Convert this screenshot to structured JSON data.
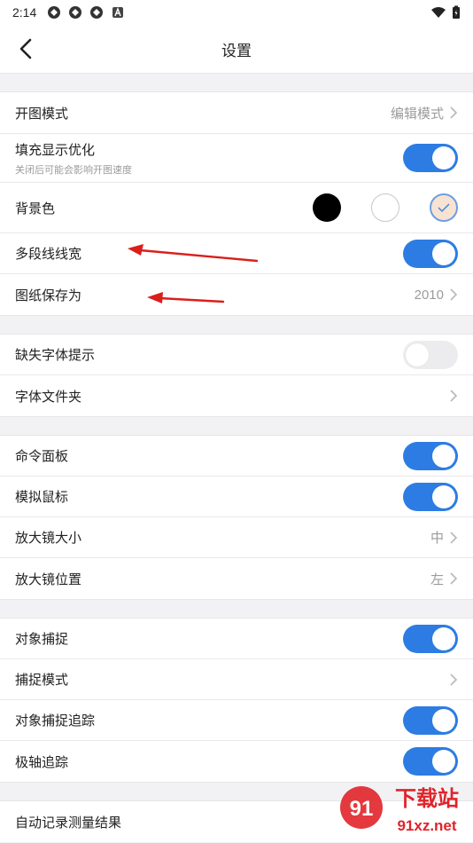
{
  "status_bar": {
    "time": "2:14"
  },
  "header": {
    "title": "设置"
  },
  "groups": {
    "display": {
      "open_mode": {
        "label": "开图模式",
        "value": "编辑模式"
      },
      "fill_opt": {
        "label": "填充显示优化",
        "sublabel": "关闭后可能会影响开图速度",
        "on": true
      },
      "bg_color": {
        "label": "背景色",
        "options": [
          "black",
          "white",
          "peach"
        ],
        "selected": "peach"
      },
      "polyline_width": {
        "label": "多段线线宽",
        "on": true
      },
      "save_as": {
        "label": "图纸保存为",
        "value": "2010"
      }
    },
    "font": {
      "missing_font": {
        "label": "缺失字体提示",
        "on": false
      },
      "font_folder": {
        "label": "字体文件夹"
      }
    },
    "input": {
      "command_panel": {
        "label": "命令面板",
        "on": true
      },
      "mouse_sim": {
        "label": "模拟鼠标",
        "on": true
      },
      "magnifier_size": {
        "label": "放大镜大小",
        "value": "中"
      },
      "magnifier_pos": {
        "label": "放大镜位置",
        "value": "左"
      }
    },
    "snap": {
      "object_snap": {
        "label": "对象捕捉",
        "on": true
      },
      "snap_mode": {
        "label": "捕捉模式"
      },
      "snap_track": {
        "label": "对象捕捉追踪",
        "on": true
      },
      "polar_track": {
        "label": "极轴追踪",
        "on": true
      }
    },
    "measure": {
      "auto_record": {
        "label": "自动记录测量结果"
      }
    }
  },
  "colors": {
    "accent": "#2d7ce3",
    "annotation_arrow": "#d9201b",
    "watermark_red": "#e0232a"
  },
  "watermark": {
    "brand": "下载站",
    "site": "91xz.net"
  }
}
